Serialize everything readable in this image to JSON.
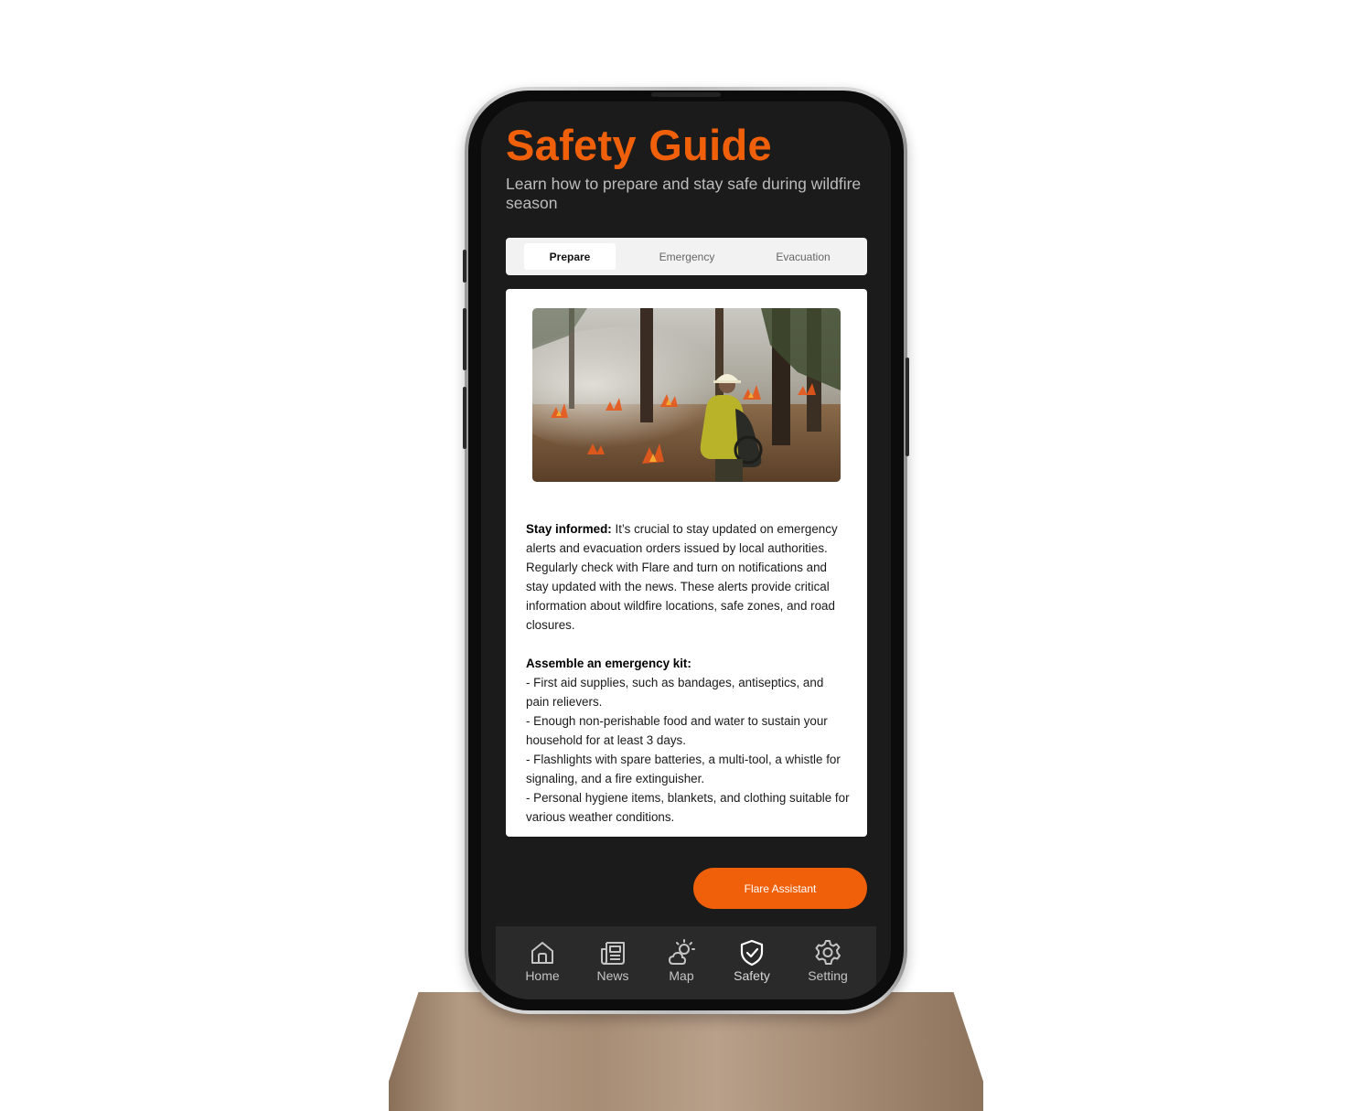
{
  "header": {
    "title": "Safety Guide",
    "subtitle": "Learn how to prepare and stay safe during wildfire season"
  },
  "tabs": [
    {
      "label": "Prepare",
      "active": true
    },
    {
      "label": "Emergency",
      "active": false
    },
    {
      "label": "Evacuation",
      "active": false
    }
  ],
  "card": {
    "image_icon": "wildfire-firefighter-photo",
    "stay_informed": {
      "heading": "Stay informed:",
      "text": "It’s crucial to stay updated on emergency alerts and evacuation orders issued by local authorities. Regularly check with Flare and turn on notifications and stay updated with the news. These alerts provide critical information about wildfire locations, safe zones, and road closures."
    },
    "emergency_kit": {
      "heading": "Assemble an emergency kit:",
      "items": [
        "- First aid supplies, such as bandages, antiseptics, and pain relievers.",
        "- Enough non-perishable food and water to sustain your household for at least 3 days.",
        "- Flashlights with spare batteries, a multi-tool, a whistle for signaling, and a fire extinguisher.",
        "- Personal hygiene items, blankets, and clothing suitable for various weather conditions."
      ]
    }
  },
  "assistant_button": {
    "label": "Flare Assistant"
  },
  "nav": [
    {
      "label": "Home",
      "icon": "home-icon"
    },
    {
      "label": "News",
      "icon": "news-icon"
    },
    {
      "label": "Map",
      "icon": "weather-icon"
    },
    {
      "label": "Safety",
      "icon": "shield-check-icon",
      "active": true
    },
    {
      "label": "Setting",
      "icon": "gear-icon"
    }
  ],
  "colors": {
    "accent": "#f0600a",
    "screen_bg": "#1b1b1b",
    "nav_bg": "#2a2a2a"
  }
}
